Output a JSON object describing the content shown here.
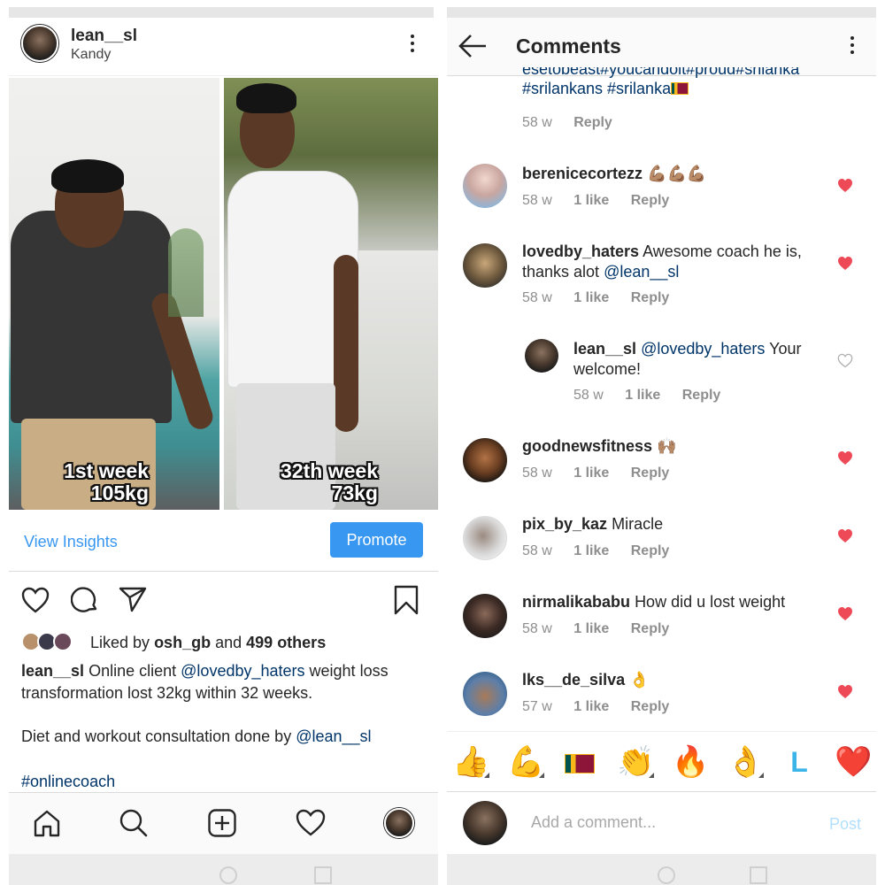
{
  "post": {
    "username": "lean__sl",
    "location": "Kandy",
    "photo_left_caption": [
      "1st week",
      "105kg"
    ],
    "photo_right_caption": [
      "32th week",
      "73kg"
    ],
    "view_insights": "View Insights",
    "promote": "Promote",
    "liked_by_prefix": "Liked by",
    "liked_by_user": "osh_gb",
    "liked_by_and": "and",
    "liked_by_others": "499 others",
    "caption_user": "lean__sl",
    "caption_text_1": "Online client",
    "caption_mention_1": "@lovedby_haters",
    "caption_text_2": "weight loss transformation lost 32kg  within 32 weeks.",
    "caption_text_3": "Diet and workout consultation done by",
    "caption_mention_2": "@lean__sl",
    "hashtag": "#onlinecoach"
  },
  "comments_screen": {
    "title": "Comments",
    "caption_tail_clipped": "esetobeast#youcandoit#proud#srilanka",
    "caption_tail_line": "#srilankans #srilanka",
    "caption_tail_age": "58 w",
    "reply_label": "Reply",
    "comments": [
      {
        "username": "berenicecortezz",
        "text": "💪🏽💪🏽💪🏽",
        "age": "58 w",
        "likes": "1 like",
        "liked": true
      },
      {
        "username": "lovedby_haters",
        "text": "Awesome coach he is, thanks alot",
        "mention": "@lean__sl",
        "age": "58 w",
        "likes": "1 like",
        "liked": true
      },
      {
        "username": "lean__sl",
        "mention": "@lovedby_haters",
        "text": "Your welcome!",
        "age": "58 w",
        "likes": "1 like",
        "liked": false,
        "is_reply": true
      },
      {
        "username": "goodnewsfitness",
        "text": "🙌🏽",
        "age": "58 w",
        "likes": "1 like",
        "liked": true
      },
      {
        "username": "pix_by_kaz",
        "text": "Miracle",
        "age": "58 w",
        "likes": "1 like",
        "liked": true
      },
      {
        "username": "nirmalikababu",
        "text": "How did u lost weight",
        "age": "58 w",
        "likes": "1 like",
        "liked": true
      },
      {
        "username": "lks__de_silva",
        "text": "👌",
        "age": "57 w",
        "likes": "1 like",
        "liked": true
      }
    ],
    "quick_emojis": [
      "👍",
      "💪",
      "flag-icon",
      "👏",
      "🔥",
      "👌",
      "L",
      "❤️"
    ],
    "compose_placeholder": "Add a comment...",
    "post_button": "Post"
  },
  "colors": {
    "link_blue": "#3897f0",
    "mention_blue": "#003569",
    "like_red": "#ed4956",
    "meta_gray": "#8e8e8e"
  }
}
